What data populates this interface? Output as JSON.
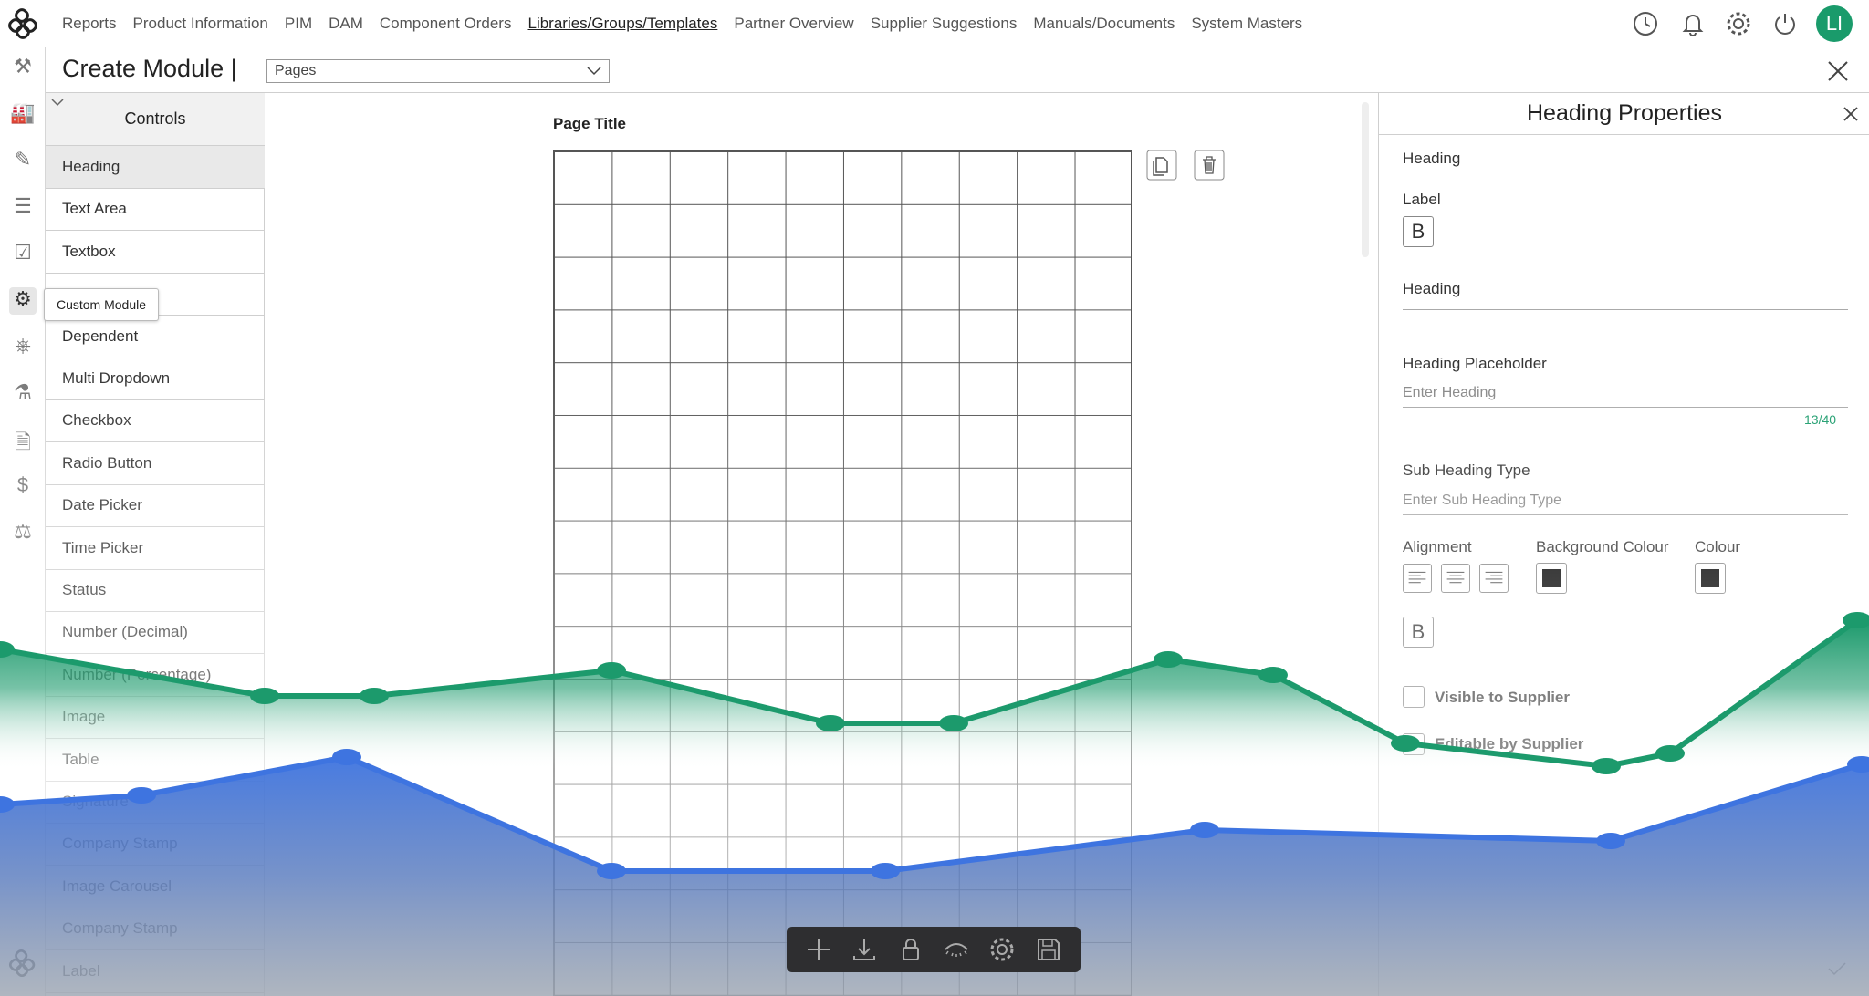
{
  "nav": {
    "links": [
      "Reports",
      "Product Information",
      "PIM",
      "DAM",
      "Component Orders",
      "Libraries/Groups/Templates",
      "Partner Overview",
      "Supplier Suggestions",
      "Manuals/Documents",
      "System Masters"
    ],
    "active": "Libraries/Groups/Templates",
    "icons": [
      "history-icon",
      "bell-icon",
      "gear-icon",
      "power-icon"
    ],
    "avatar": "LI"
  },
  "rail_icons": [
    "dashboard-icon",
    "building-icon",
    "ruler-icon",
    "list-icon",
    "checklist-icon",
    "custom-module-icon",
    "passport-icon",
    "flask-icon",
    "document-icon",
    "dollar-icon",
    "org-icon"
  ],
  "header": {
    "title": "Create Module |",
    "select_value": "Pages"
  },
  "controls": {
    "title": "Controls",
    "tooltip": "Custom Module",
    "items": [
      "Heading",
      "Text Area",
      "Textbox",
      "",
      "Dependent",
      "Multi Dropdown",
      "Checkbox",
      "Radio Button",
      "Date Picker",
      "Time Picker",
      "Status",
      "Number (Decimal)",
      "Number (Percentage)",
      "Image",
      "Table",
      "Signature",
      "Company Stamp",
      "Image Carousel",
      "Company Stamp",
      "Label"
    ]
  },
  "canvas": {
    "title": "Page Title"
  },
  "props": {
    "title": "Heading Properties",
    "type_label": "Heading",
    "label_label": "Label",
    "bold_glyph": "B",
    "heading_label": "Heading",
    "placeholder_label": "Heading Placeholder",
    "placeholder_hint": "Enter Heading",
    "char_count": "13/40",
    "subheading_label": "Sub Heading Type",
    "subheading_hint": "Enter Sub Heading Type",
    "alignment_label": "Alignment",
    "bg_colour_label": "Background Colour",
    "colour_label": "Colour",
    "bg_colour": "#000000",
    "colour": "#000000",
    "visible_label": "Visible to Supplier",
    "editable_label": "Editable by Supplier"
  },
  "toolbar": {
    "icons": [
      "plus-icon",
      "download-icon",
      "lock-icon",
      "eye-icon",
      "gear-icon",
      "save-icon"
    ]
  },
  "colors": {
    "accent": "#1a9b6b",
    "green_series": "#1c9a6c",
    "blue_series": "#3e74e0"
  },
  "chart_data": {
    "type": "area",
    "x": [
      0,
      290,
      410,
      670,
      910,
      1045,
      1280,
      1395,
      1540,
      1760,
      1830,
      2035
    ],
    "series": [
      {
        "values": [
          712,
          763,
          763,
          735,
          793,
          793,
          723,
          740,
          815,
          840,
          826,
          680
        ]
      },
      {
        "x": [
          0,
          155,
          380,
          670,
          970,
          1320,
          1765,
          2040
        ],
        "values": [
          882,
          872,
          830,
          955,
          955,
          910,
          922,
          838
        ]
      }
    ]
  }
}
